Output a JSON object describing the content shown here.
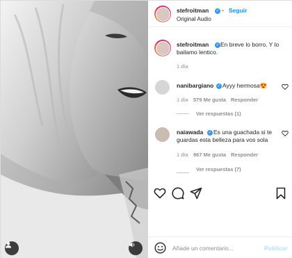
{
  "post": {
    "username": "stefroitman",
    "follow_label": "Seguir",
    "audio_label": "Original Audio",
    "separator": "•"
  },
  "caption": {
    "username": "stefroitman",
    "text_line1": "En breve lo borro. Y lo",
    "text_line2": "bailamo lentico.",
    "time": "1 día"
  },
  "comments": [
    {
      "username": "nanibargiano",
      "text": "Ayyy hermosa😍",
      "time": "1 día",
      "likes": "579 Me gusta",
      "reply_label": "Responder",
      "view_replies": "Ver respuestas (1)"
    },
    {
      "username": "naiawada",
      "text_line1": "Es una guachada si te",
      "text_line2": "guardas esta belleza para vos sola",
      "time": "1 día",
      "likes": "967 Me gusta",
      "reply_label": "Responder",
      "view_replies": "Ver respuestas (7)"
    }
  ],
  "composer": {
    "placeholder": "Añade un comentario...",
    "publish_label": "Publicar"
  },
  "colors": {
    "link_blue": "#0095f6",
    "verified_blue": "#3897f0",
    "muted": "#8e8e8e"
  },
  "icons": {
    "media_user": "user-icon",
    "media_audio": "speaker-icon",
    "like": "heart-icon",
    "comment": "comment-icon",
    "share": "paper-plane-icon",
    "save": "bookmark-icon",
    "emoji": "emoji-icon",
    "comment_like": "heart-icon"
  }
}
